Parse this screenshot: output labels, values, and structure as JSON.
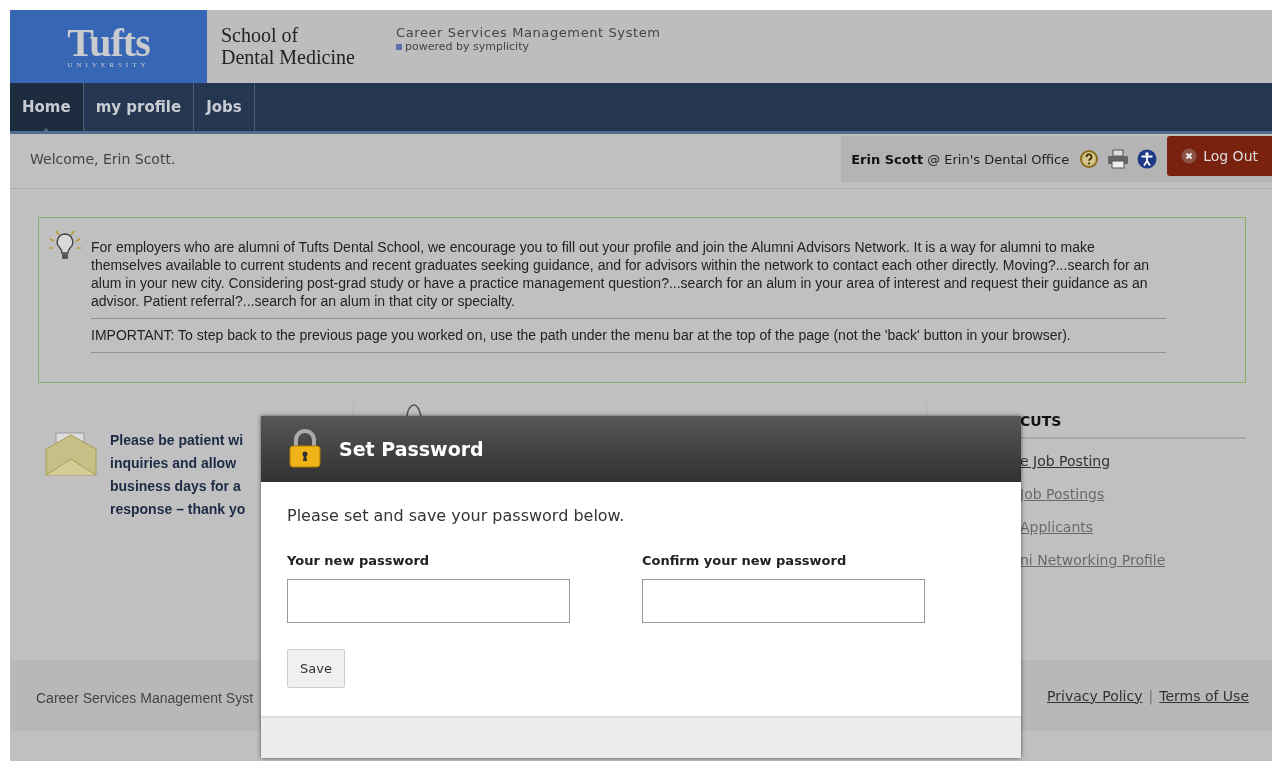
{
  "header": {
    "logo": "Tufts",
    "logo_sub": "UNIVERSITY",
    "school": [
      "School of",
      "Dental Medicine"
    ],
    "system": "Career Services Management System",
    "powered": "powered by symplicity"
  },
  "nav": [
    {
      "label": "Home",
      "selected": true
    },
    {
      "label": "my profile",
      "selected": false
    },
    {
      "label": "Jobs",
      "selected": false
    }
  ],
  "welcome": "Welcome, Erin Scott.",
  "user": {
    "name": "Erin Scott",
    "at": "@ Erin's Dental Office",
    "logout": "Log Out"
  },
  "tip": {
    "text": "For employers who are alumni of Tufts Dental School, we encourage you to fill out your profile and join the Alumni Advisors Network. It is a way for alumni to make themselves available to current students and recent graduates seeking guidance, and for advisors within the network to contact each other directly. Moving?...search for an alum in your new city. Considering post-grad study or have a practice management question?...search for an alum in your area of interest and request their guidance as an advisor. Patient referral?...search for an alum in that city or specialty.",
    "important": "IMPORTANT: To step back to the previous page you worked on, use the path under the menu bar at the top of the page (not the 'back' button in your browser)."
  },
  "notice": [
    "Please be patient wi",
    "inquiries and allow",
    "business days for a",
    "response – thank yo"
  ],
  "shortcuts": {
    "title": "CUTS",
    "links": [
      "e Job Posting",
      "Job Postings",
      "Applicants",
      "ni Networking Profile"
    ]
  },
  "footer": {
    "text": "Career Services Management Syst",
    "links": [
      "Privacy Policy",
      "Terms of Use"
    ],
    "separator": "|"
  },
  "dialog": {
    "title": "Set Password",
    "message": "Please set and save your password below.",
    "fields": [
      {
        "label": "Your new password"
      },
      {
        "label": "Confirm your new password"
      }
    ],
    "button": "Save"
  }
}
